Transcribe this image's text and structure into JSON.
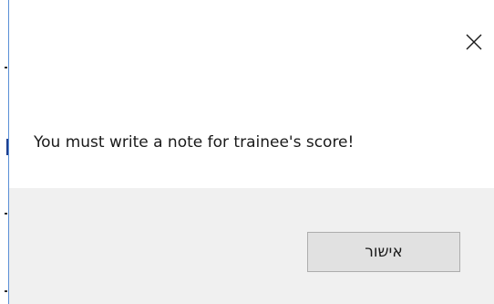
{
  "dialog": {
    "message": "You must write a note for trainee's score!",
    "ok_label": "אישור",
    "close_icon": "close-icon"
  },
  "colors": {
    "dialog_bg": "#ffffff",
    "footer_bg": "#f0f0f0",
    "button_bg": "#e1e1e1",
    "button_border": "#adadad",
    "frame_accent": "#5a8fd6"
  }
}
